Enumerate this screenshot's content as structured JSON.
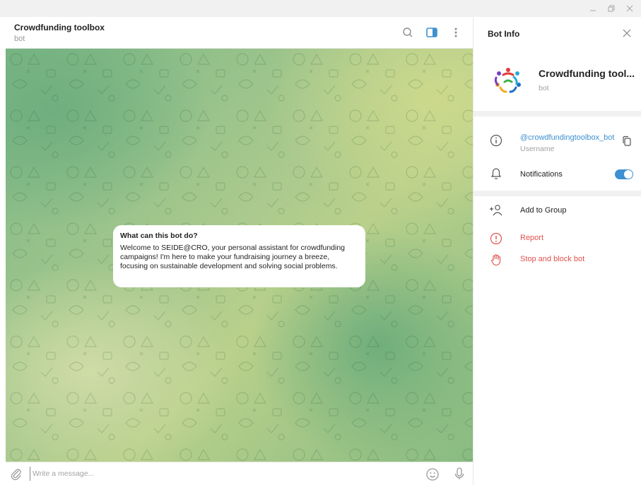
{
  "window": {
    "controls": [
      "minimize",
      "maximize",
      "close"
    ]
  },
  "chat": {
    "title": "Crowdfunding toolbox",
    "status": "bot",
    "header_icons": [
      "search-icon",
      "sidebar-toggle-icon",
      "more-vertical-icon"
    ],
    "info_card": {
      "title": "What can this bot do?",
      "text": "Welcome to SEIDE@CRO, your personal assistant for crowdfunding campaigns! I'm here to make your fundraising journey a breeze, focusing on sustainable development and solving social problems."
    },
    "compose": {
      "placeholder": "Write a message...",
      "value": ""
    }
  },
  "panel": {
    "title": "Bot Info",
    "bot_name": "Crowdfunding tool...",
    "bot_subtitle": "bot",
    "username": "@crowdfundingtoolbox_bot",
    "username_label": "Username",
    "notifications_label": "Notifications",
    "notifications_on": true,
    "actions": [
      {
        "label": "Add to Group",
        "icon": "add-user-icon",
        "color": "#222222"
      },
      {
        "label": "Report",
        "icon": "report-icon",
        "color": "#e0524f"
      },
      {
        "label": "Stop and block bot",
        "icon": "hand-stop-icon",
        "color": "#e0524f"
      }
    ]
  },
  "colors": {
    "accent": "#3d91d0",
    "danger": "#e0524f"
  }
}
